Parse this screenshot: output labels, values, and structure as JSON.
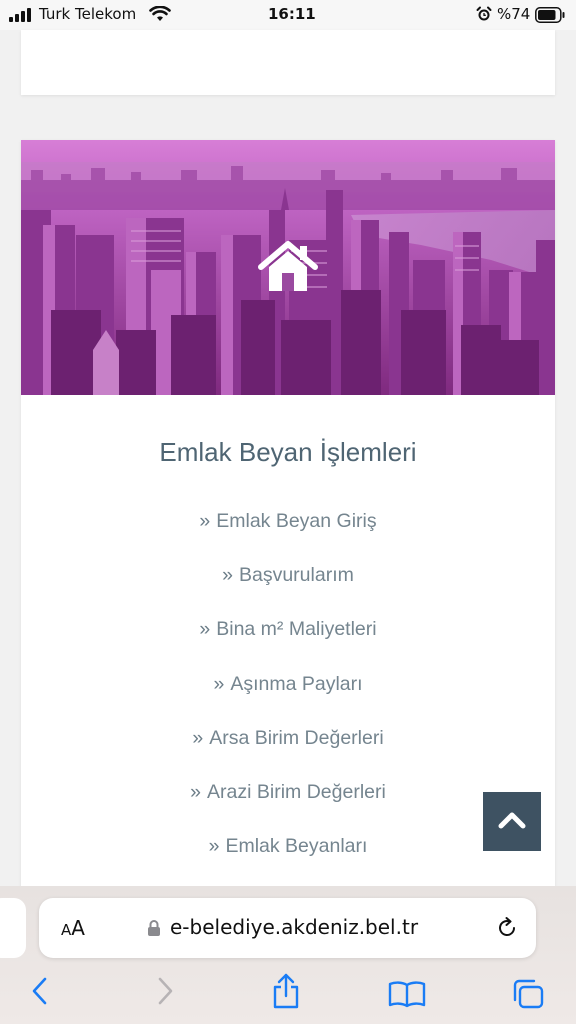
{
  "status_bar": {
    "carrier": "Turk Telekom",
    "time": "16:11",
    "battery": "%74"
  },
  "section": {
    "title": "Emlak Beyan İşlemleri",
    "items": [
      {
        "label": "Emlak Beyan Giriş"
      },
      {
        "label": "Başvurularım"
      },
      {
        "label": "Bina m² Maliyetleri"
      },
      {
        "label": "Aşınma Payları"
      },
      {
        "label": "Arsa Birim Değerleri"
      },
      {
        "label": "Arazi Birim Değerleri"
      },
      {
        "label": "Emlak Beyanları"
      }
    ]
  },
  "browser": {
    "text_size_label": "AA",
    "url": "e-belediye.akdeniz.bel.tr"
  },
  "icons": {
    "hero": "home-icon",
    "scroll_top": "chevron-up-icon",
    "toolbar": [
      "back-icon",
      "forward-icon",
      "share-icon",
      "bookmarks-icon",
      "tabs-icon"
    ]
  },
  "colors": {
    "accent_dark": "#3e5262",
    "title": "#4f6573",
    "link": "#75858f",
    "ios_blue": "#1a7cf5",
    "hero_tint": "#b03ab8"
  }
}
